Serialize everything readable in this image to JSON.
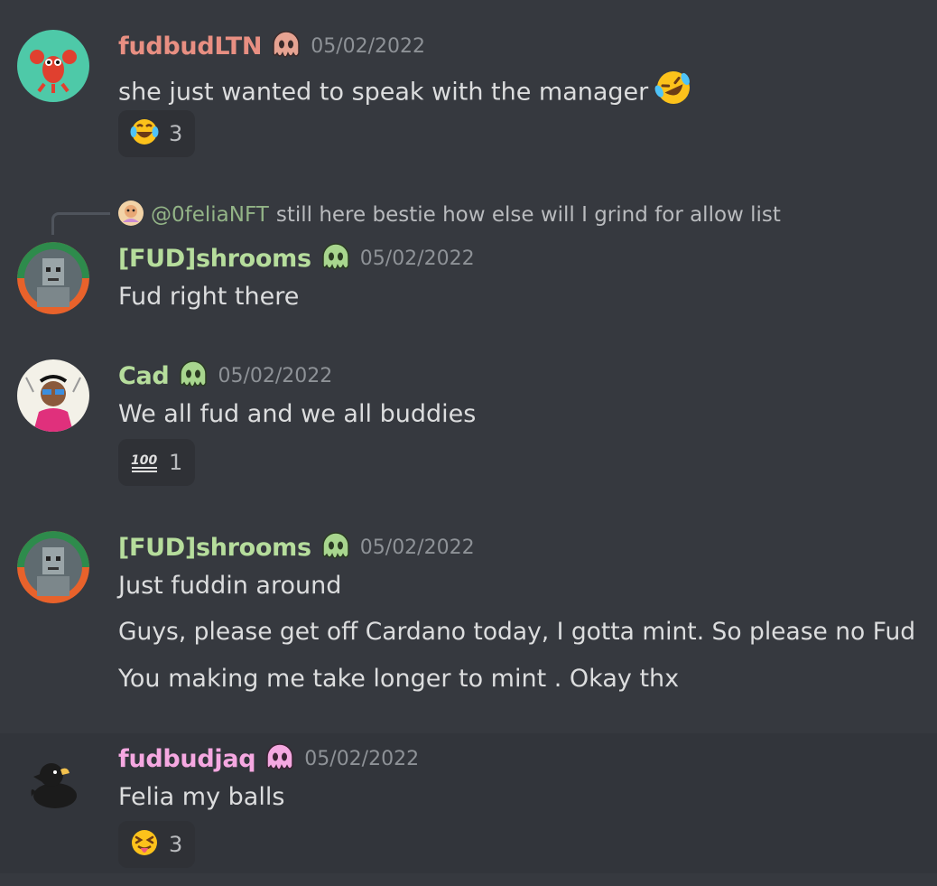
{
  "colors": {
    "background": "#36393f",
    "username_fudbudLTN": "#e88f82",
    "username_shrooms": "#b6dd9c",
    "username_cad": "#b6dd9c",
    "username_fudbudjaq": "#f5a8e1",
    "timestamp": "#8e9297",
    "reaction_bg": "#2f3136"
  },
  "messages": [
    {
      "author": "fudbudLTN",
      "avatar_icon": "lobster-avatar",
      "role_icon": "melting-face-role-icon",
      "timestamp": "05/02/2022",
      "lines": [
        "she just wanted to speak with the manager"
      ],
      "inline_emoji": "rofl-emoji",
      "reaction": {
        "emoji": "joy-emoji",
        "count": "3"
      }
    },
    {
      "author": "[FUD]shrooms",
      "avatar_icon": "pixel-character-avatar",
      "role_icon": "melting-face-role-icon",
      "timestamp": "05/02/2022",
      "reply": {
        "avatar_icon": "small-reply-avatar",
        "mention": "@0feliaNFT",
        "text": "still here bestie how else will I grind for allow list"
      },
      "lines": [
        "Fud right there"
      ]
    },
    {
      "author": "Cad",
      "avatar_icon": "cartoon-person-avatar",
      "role_icon": "melting-face-role-icon",
      "timestamp": "05/02/2022",
      "lines": [
        "We all fud and we all buddies"
      ],
      "reaction": {
        "emoji": "hundred-emoji",
        "count": "1"
      }
    },
    {
      "author": "[FUD]shrooms",
      "avatar_icon": "pixel-character-avatar",
      "role_icon": "melting-face-role-icon",
      "timestamp": "05/02/2022",
      "lines": [
        "Just fuddin around",
        "Guys, please get off Cardano today, I gotta mint. So please no Fud",
        "You making me take longer to mint . Okay thx"
      ]
    },
    {
      "author": "fudbudjaq",
      "avatar_icon": "black-duck-avatar",
      "role_icon": "melting-face-role-icon",
      "timestamp": "05/02/2022",
      "lines": [
        "Felia my balls"
      ],
      "reaction": {
        "emoji": "tongue-squint-emoji",
        "count": "3"
      }
    }
  ]
}
